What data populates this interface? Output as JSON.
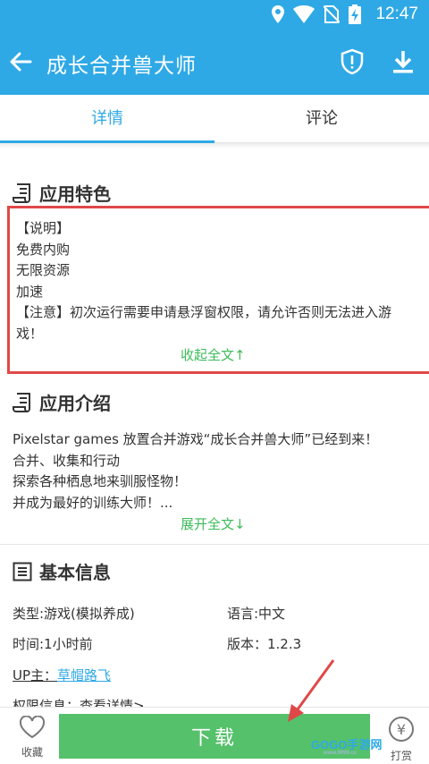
{
  "status_bar": {
    "time": "12:47"
  },
  "app_bar": {
    "title": "成长合并兽大师"
  },
  "tabs": [
    {
      "label": "详情"
    },
    {
      "label": "评论"
    }
  ],
  "features": {
    "heading": "应用特色",
    "lines": [
      "【说明】",
      "免费内购",
      "无限资源",
      "加速",
      "【注意】初次运行需要申请悬浮窗权限，请允许否则无法进入游",
      "戏！"
    ],
    "collapse_label": "收起全文↑"
  },
  "intro": {
    "heading": "应用介绍",
    "lines": [
      "Pixelstar games 放置合并游戏“成长合并兽大师”已经到来！",
      "合并、收集和行动",
      "探索各种栖息地来驯服怪物！",
      "并成为最好的训练大师！..."
    ],
    "expand_label": "展开全文↓"
  },
  "basic_info": {
    "heading": "基本信息",
    "type": "类型:游戏(模拟养成)",
    "language": "语言:中文",
    "time": "时间:1小时前",
    "version": "版本：1.2.3",
    "up_label": "UP主：",
    "up_name": "草帽路飞",
    "permission": "权限信息：查看详情>"
  },
  "bottom_bar": {
    "favorite_label": "收藏",
    "download_label": "下载",
    "tip_label": "打赏",
    "tip_symbol": "¥"
  },
  "watermark": {
    "brand": "GOGO手游网",
    "url": "www.9999.cc"
  },
  "colors": {
    "primary": "#2fa9e6",
    "green": "#55c16b",
    "link_green": "#3dbb5a",
    "highlight_red": "#e04848"
  }
}
